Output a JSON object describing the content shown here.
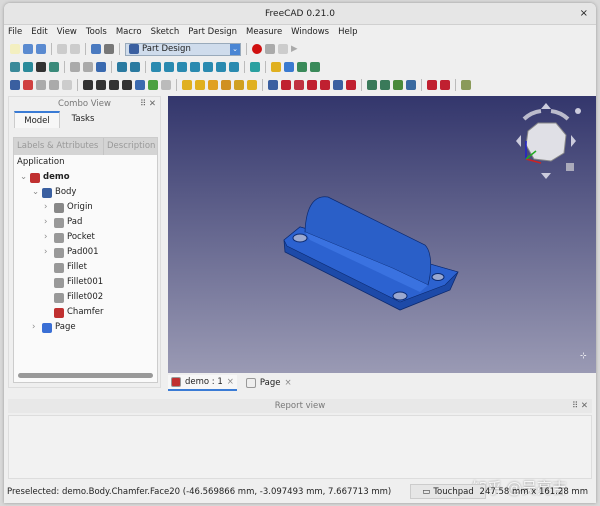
{
  "window": {
    "title": "FreeCAD 0.21.0",
    "close": "×"
  },
  "menu": [
    "File",
    "Edit",
    "View",
    "Tools",
    "Macro",
    "Sketch",
    "Part Design",
    "Measure",
    "Windows",
    "Help"
  ],
  "toolbar": {
    "workbench": "Part Design",
    "dropdown": "⌄"
  },
  "combo": {
    "title": "Combo View",
    "controls": "⠿ ✕",
    "tabs": [
      "Model",
      "Tasks"
    ],
    "columns": [
      "Labels & Attributes",
      "Description"
    ],
    "root": "Application",
    "tree": [
      {
        "label": "demo",
        "depth": 0,
        "exp": "⌄",
        "icon": "document-icon",
        "bold": true,
        "color": "#c03030"
      },
      {
        "label": "Body",
        "depth": 1,
        "exp": "⌄",
        "icon": "body-icon",
        "color": "#3a5fa0"
      },
      {
        "label": "Origin",
        "depth": 2,
        "exp": "›",
        "icon": "origin-icon",
        "color": "#888"
      },
      {
        "label": "Pad",
        "depth": 2,
        "exp": "›",
        "icon": "pad-icon",
        "color": "#999"
      },
      {
        "label": "Pocket",
        "depth": 2,
        "exp": "›",
        "icon": "pocket-icon",
        "color": "#999"
      },
      {
        "label": "Pad001",
        "depth": 2,
        "exp": "›",
        "icon": "pad-icon",
        "color": "#999"
      },
      {
        "label": "Fillet",
        "depth": 2,
        "exp": "",
        "icon": "fillet-icon",
        "color": "#999"
      },
      {
        "label": "Fillet001",
        "depth": 2,
        "exp": "",
        "icon": "fillet-icon",
        "color": "#999"
      },
      {
        "label": "Fillet002",
        "depth": 2,
        "exp": "",
        "icon": "fillet-icon",
        "color": "#999"
      },
      {
        "label": "Chamfer",
        "depth": 2,
        "exp": "",
        "icon": "chamfer-icon",
        "color": "#c03030"
      },
      {
        "label": "Page",
        "depth": 1,
        "exp": "›",
        "icon": "page-icon",
        "color": "#3a6fd5"
      }
    ]
  },
  "doc_tabs": [
    {
      "label": "demo : 1",
      "close": "×"
    },
    {
      "label": "Page",
      "close": "×"
    }
  ],
  "report": {
    "title": "Report view",
    "controls": "⠿ ✕"
  },
  "status": {
    "message": "Preselected: demo.Body.Chamfer.Face20 (-46.569866 mm, -3.097493 mm, 7.667713 mm)",
    "nav_style": "Touchpad",
    "dimensions": "247.58 mm x 161.28 mm"
  },
  "watermark": "知乎 @吴亮吉",
  "colors": {
    "model": "#2a5fc8",
    "accent": "#3a7bd5",
    "record": "#d01010"
  }
}
